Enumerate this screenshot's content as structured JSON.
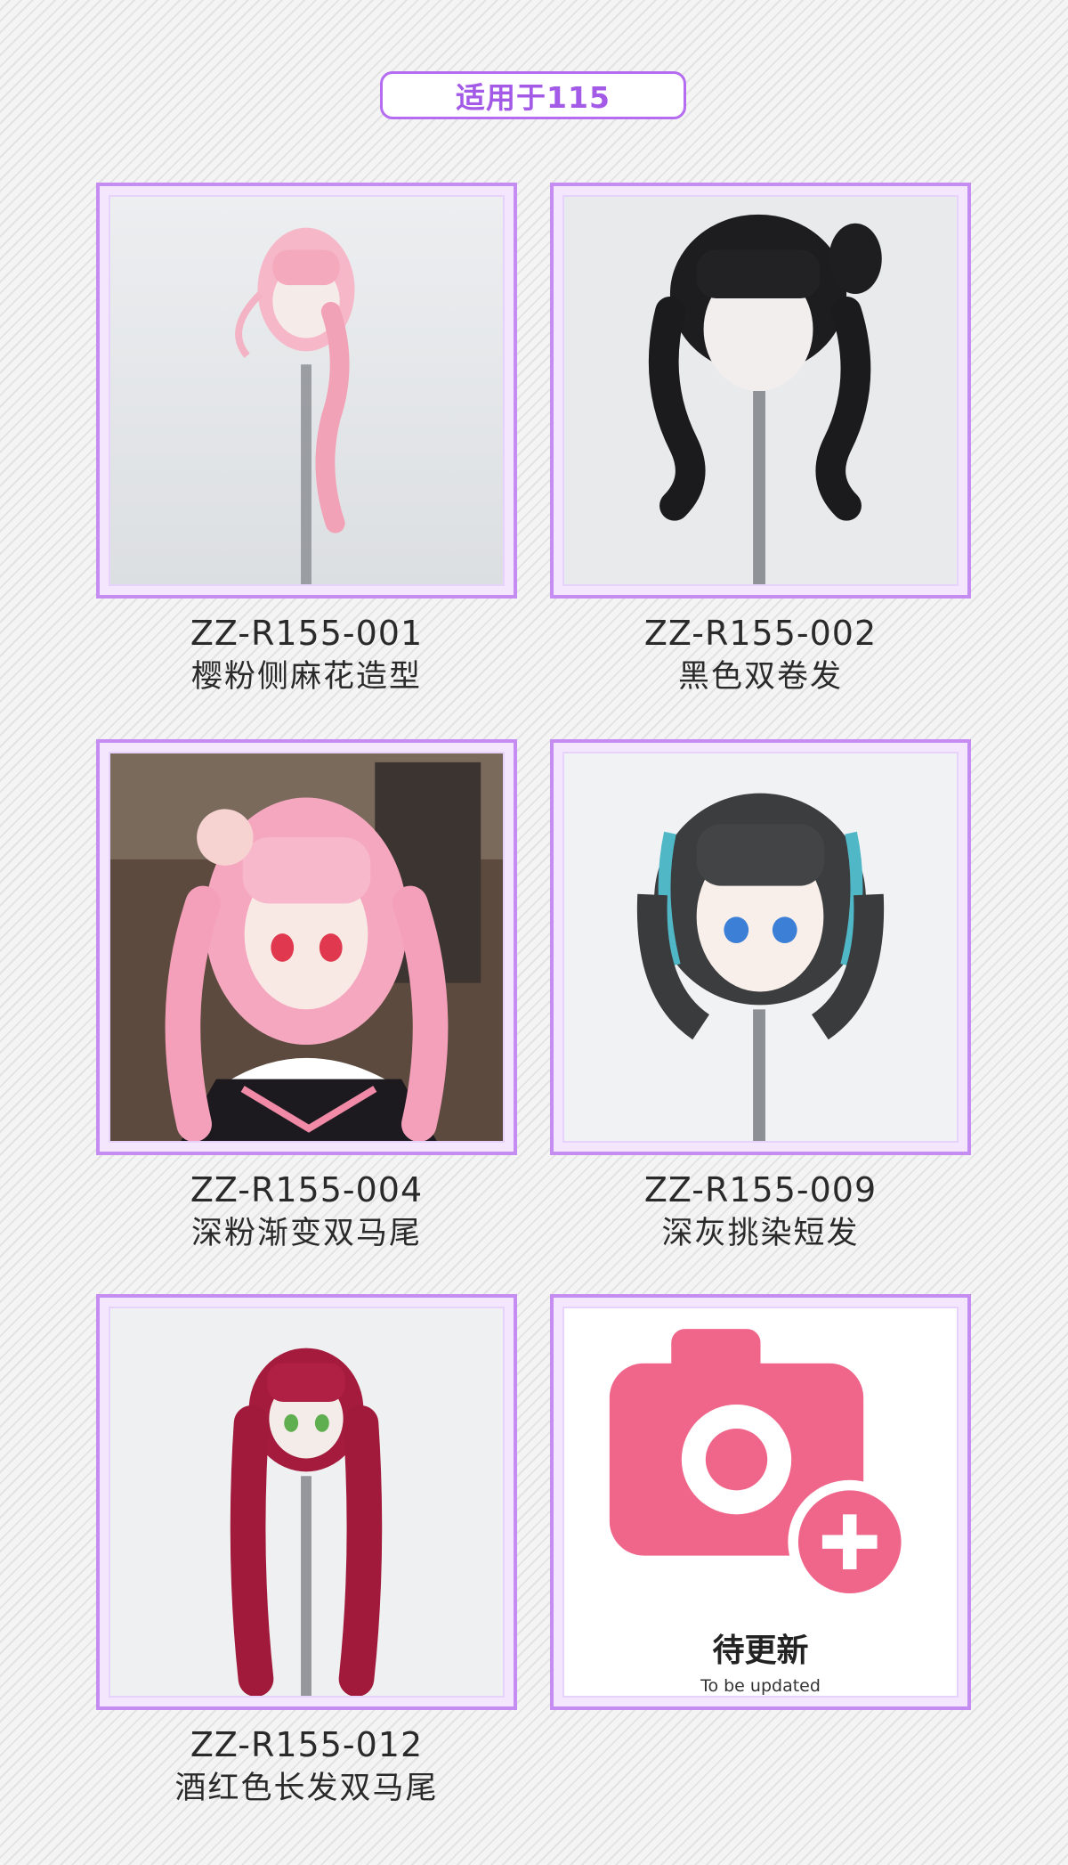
{
  "header": {
    "title": "适用于115"
  },
  "products": [
    {
      "code": "ZZ-R155-001",
      "name": "樱粉侧麻花造型",
      "image": "pink-braid-wig-photo"
    },
    {
      "code": "ZZ-R155-002",
      "name": "黑色双卷发",
      "image": "black-twin-curls-wig-photo"
    },
    {
      "code": "ZZ-R155-004",
      "name": "深粉渐变双马尾",
      "image": "deep-pink-gradient-twintails-doll-photo"
    },
    {
      "code": "ZZ-R155-009",
      "name": "深灰挑染短发",
      "image": "dark-gray-highlight-bob-wig-photo"
    },
    {
      "code": "ZZ-R155-012",
      "name": "酒红色长发双马尾",
      "image": "wine-red-long-twintails-wig-photo"
    }
  ],
  "placeholder": {
    "title": "待更新",
    "subtitle": "To be updated",
    "icon": "camera-add-icon"
  },
  "colors": {
    "accent": "#b46cf0",
    "card_border": "#c58df2",
    "icon_pink": "#f0658a"
  }
}
